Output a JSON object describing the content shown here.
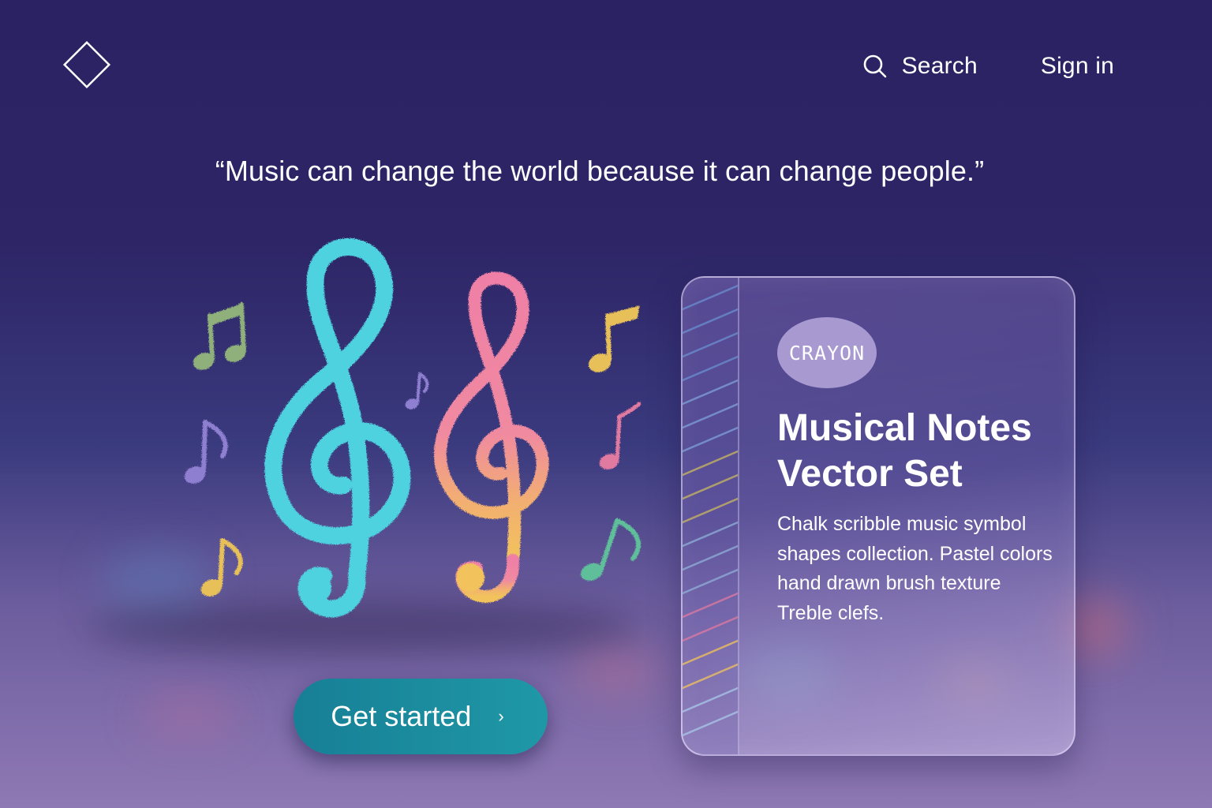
{
  "header": {
    "search_label": "Search",
    "signin_label": "Sign in"
  },
  "hero": {
    "quote": "“Music can change the world because it can change people.”",
    "cta_label": "Get started",
    "cta_chevron": "›"
  },
  "card": {
    "badge": "CRAYON",
    "title": "Musical Notes Vector Set",
    "description": "Chalk scribble music symbol shapes collection. Pastel colors hand drawn brush texture Treble clefs."
  },
  "colors": {
    "background_top": "#2a2262",
    "background_bottom": "#8f79b4",
    "cta": "#1a8a9e",
    "badge": "#a89ad0",
    "clef_cyan": "#4fd2e0",
    "clef_pink": "#ef7fa6",
    "clef_gold": "#f2c35c",
    "note_green": "#8fb07a",
    "note_purple": "#8f7fd0",
    "note_gold": "#e8c05a",
    "note_pink": "#e07aa0",
    "note_teal": "#5fbf9a"
  },
  "icons": [
    "diamond-logo-icon",
    "search-icon",
    "chevron-right-icon",
    "treble-clef-icon",
    "eighth-note-icon",
    "beamed-notes-icon"
  ]
}
